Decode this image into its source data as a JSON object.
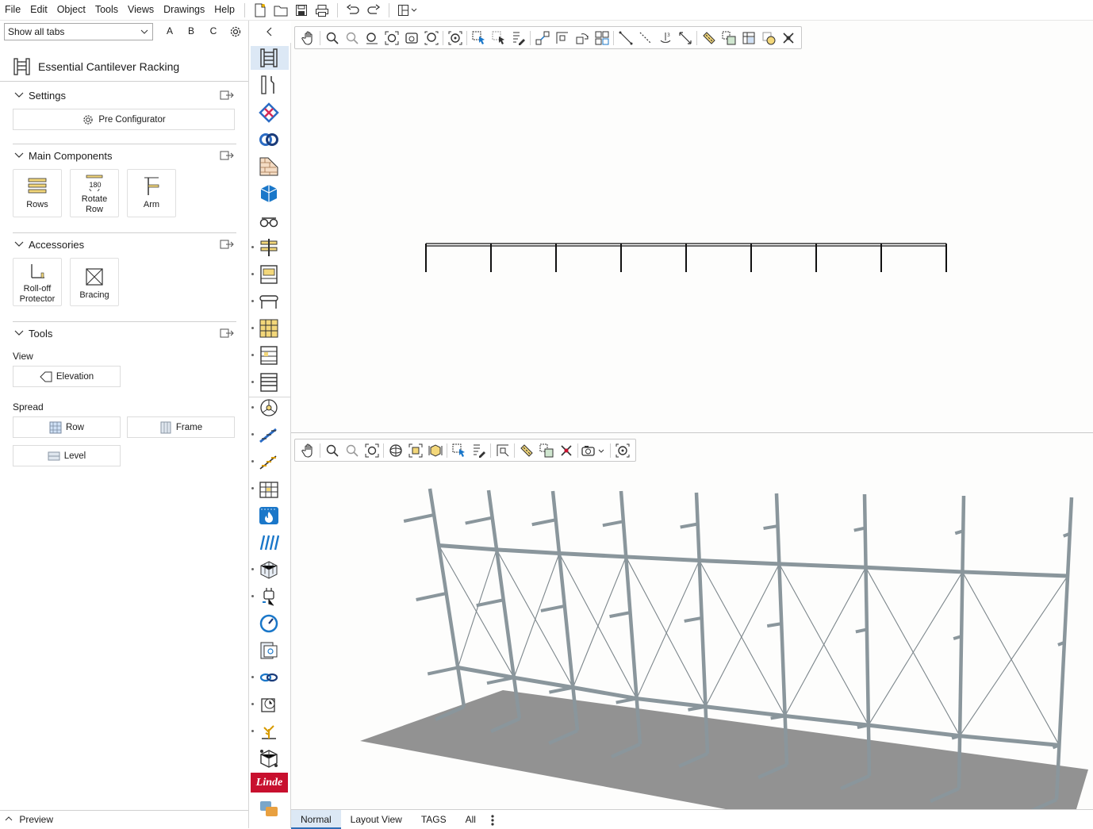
{
  "menubar": {
    "items": [
      "File",
      "Edit",
      "Object",
      "Tools",
      "Views",
      "Drawings",
      "Help"
    ]
  },
  "leftpanel": {
    "tab_select": "Show all tabs",
    "tab_letters": [
      "A",
      "B",
      "C"
    ],
    "title": "Essential Cantilever Racking",
    "settings": {
      "heading": "Settings",
      "pre_configurator": "Pre Configurator"
    },
    "main_components": {
      "heading": "Main Components",
      "rows": "Rows",
      "rotate_row": "Rotate Row",
      "rotate_badge": "180",
      "arm": "Arm"
    },
    "accessories": {
      "heading": "Accessories",
      "rolloff": "Roll-off Protector",
      "bracing": "Bracing"
    },
    "tools": {
      "heading": "Tools",
      "view_label": "View",
      "elevation": "Elevation",
      "spread_label": "Spread",
      "row": "Row",
      "frame": "Frame",
      "level": "Level"
    },
    "preview": "Preview"
  },
  "strip": {
    "brand": "Linde"
  },
  "bottom_tabs": [
    "Normal",
    "Layout View",
    "TAGS",
    "All"
  ],
  "colors": {
    "accent": "#2d6db5",
    "steel": "#8a969c",
    "floor": "#8c8c8c",
    "brand_red": "#c8102e"
  },
  "icons": {
    "toolbar": [
      "new-file-icon",
      "open-folder-icon",
      "save-icon",
      "print-icon",
      "undo-icon",
      "redo-icon",
      "layout-icon"
    ],
    "strip": [
      "racking-icon",
      "tools-icon",
      "mesh-icon",
      "rings-icon",
      "wall-icon",
      "3d-cube-icon",
      "glasses-icon",
      "beam-icon",
      "pallet-icon",
      "conveyor-icon",
      "grid-rack-icon",
      "shelf-icon",
      "ladder-icon",
      "hub-icon",
      "stairs-icon",
      "stairs-2-icon",
      "building-icon",
      "fire-icon",
      "ramp-icon",
      "box-mesh-icon",
      "plug-icon",
      "gauge-icon",
      "book-icon",
      "chain-icon",
      "clock-icon",
      "plant-icon",
      "network-cube-icon",
      "linde-logo",
      "shapes-icon"
    ]
  }
}
